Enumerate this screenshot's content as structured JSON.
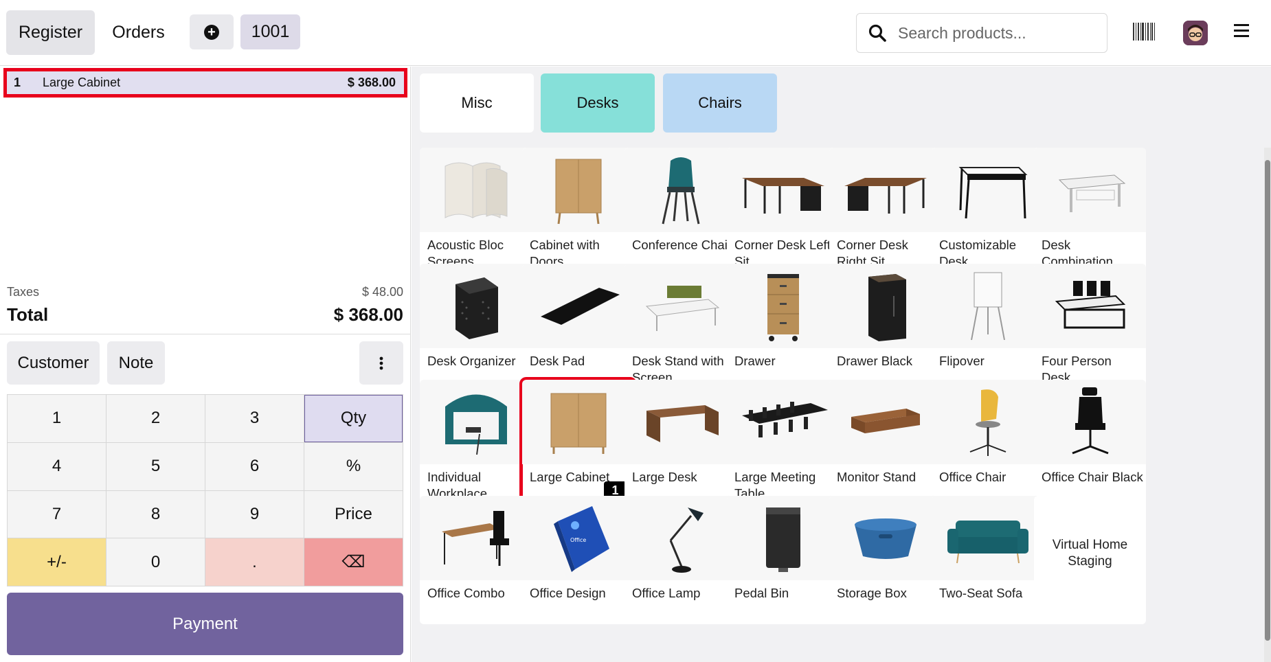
{
  "header": {
    "register_label": "Register",
    "orders_label": "Orders",
    "order_number": "1001",
    "search_placeholder": "Search products..."
  },
  "order": {
    "lines": [
      {
        "qty": "1",
        "name": "Large Cabinet",
        "price": "$ 368.00"
      }
    ],
    "taxes_label": "Taxes",
    "taxes_value": "$ 48.00",
    "total_label": "Total",
    "total_value": "$ 368.00"
  },
  "controls": {
    "customer_label": "Customer",
    "note_label": "Note"
  },
  "numpad": {
    "keys": [
      "1",
      "2",
      "3",
      "Qty",
      "4",
      "5",
      "6",
      "%",
      "7",
      "8",
      "9",
      "Price",
      "+/-",
      "0",
      ".",
      "⌫"
    ]
  },
  "payment_label": "Payment",
  "categories": [
    {
      "label": "Misc"
    },
    {
      "label": "Desks"
    },
    {
      "label": "Chairs"
    }
  ],
  "products": [
    {
      "name": "Acoustic Bloc Screens",
      "bar": "gray"
    },
    {
      "name": "Cabinet with Doors",
      "bar": "gray"
    },
    {
      "name": "Conference Chair",
      "bar": "blue"
    },
    {
      "name": "Corner Desk Left Sit",
      "bar": "green"
    },
    {
      "name": "Corner Desk Right Sit",
      "bar": "green"
    },
    {
      "name": "Customizable Desk",
      "bar": "green"
    },
    {
      "name": "Desk Combination",
      "bar": "green"
    },
    {
      "name": "Desk Organizer",
      "bar": "gray"
    },
    {
      "name": "Desk Pad",
      "bar": "gray"
    },
    {
      "name": "Desk Stand with Screen",
      "bar": "gray"
    },
    {
      "name": "Drawer",
      "bar": "gray"
    },
    {
      "name": "Drawer Black",
      "bar": "gray"
    },
    {
      "name": "Flipover",
      "bar": "gray"
    },
    {
      "name": "Four Person Desk",
      "bar": "green"
    },
    {
      "name": "Individual Workplace",
      "bar": "gray"
    },
    {
      "name": "Large Cabinet",
      "bar": "none",
      "badge": "1"
    },
    {
      "name": "Large Desk",
      "bar": "green"
    },
    {
      "name": "Large Meeting Table",
      "bar": "gray"
    },
    {
      "name": "Monitor Stand",
      "bar": "gray"
    },
    {
      "name": "Office Chair",
      "bar": "blue"
    },
    {
      "name": "Office Chair Black",
      "bar": "blue"
    },
    {
      "name": "Office Combo",
      "bar": "none"
    },
    {
      "name": "Office Design",
      "bar": "none"
    },
    {
      "name": "Office Lamp",
      "bar": "none"
    },
    {
      "name": "Pedal Bin",
      "bar": "none"
    },
    {
      "name": "Storage Box",
      "bar": "none"
    },
    {
      "name": "Two-Seat Sofa",
      "bar": "none"
    },
    {
      "name": "Virtual Home Staging",
      "bar": "none"
    }
  ]
}
